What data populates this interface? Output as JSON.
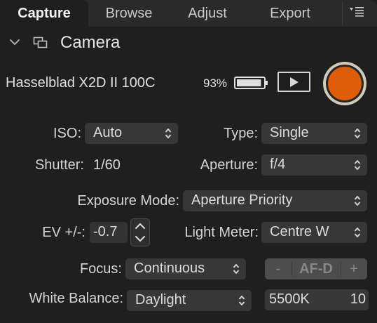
{
  "tabs": [
    {
      "label": "Capture",
      "active": true
    },
    {
      "label": "Browse",
      "active": false
    },
    {
      "label": "Adjust",
      "active": false
    },
    {
      "label": "Export",
      "active": false
    }
  ],
  "menu_icon": "list-menu-icon",
  "section": {
    "title": "Camera",
    "expanded": true,
    "icon": "camera-windows-icon"
  },
  "camera": {
    "name": "Hasselblad X2D II 100C",
    "battery_percent_label": "93%",
    "battery_level": 0.93,
    "play_icon": "play-icon",
    "record_color": "#df5d06"
  },
  "settings": {
    "iso": {
      "label": "ISO:",
      "value": "Auto"
    },
    "type": {
      "label": "Type:",
      "value": "Single"
    },
    "shutter": {
      "label": "Shutter:",
      "value": "1/60"
    },
    "aperture": {
      "label": "Aperture:",
      "value": "f/4"
    },
    "exposure_mode": {
      "label": "Exposure Mode:",
      "value": "Aperture Priority"
    },
    "ev": {
      "label": "EV +/-:",
      "value": "-0.7"
    },
    "light_meter": {
      "label": "Light Meter:",
      "value": "Centre W"
    },
    "focus": {
      "label": "Focus:",
      "value": "Continuous"
    },
    "af": {
      "minus": "-",
      "label": "AF-D",
      "plus": "+"
    },
    "white_balance": {
      "label": "White Balance:",
      "value": "Daylight",
      "kelvin": "5500K",
      "tint": "10"
    }
  },
  "colors": {
    "accent_record": "#df5d06",
    "background": "#1f1f1f",
    "control_bg": "#373737"
  }
}
